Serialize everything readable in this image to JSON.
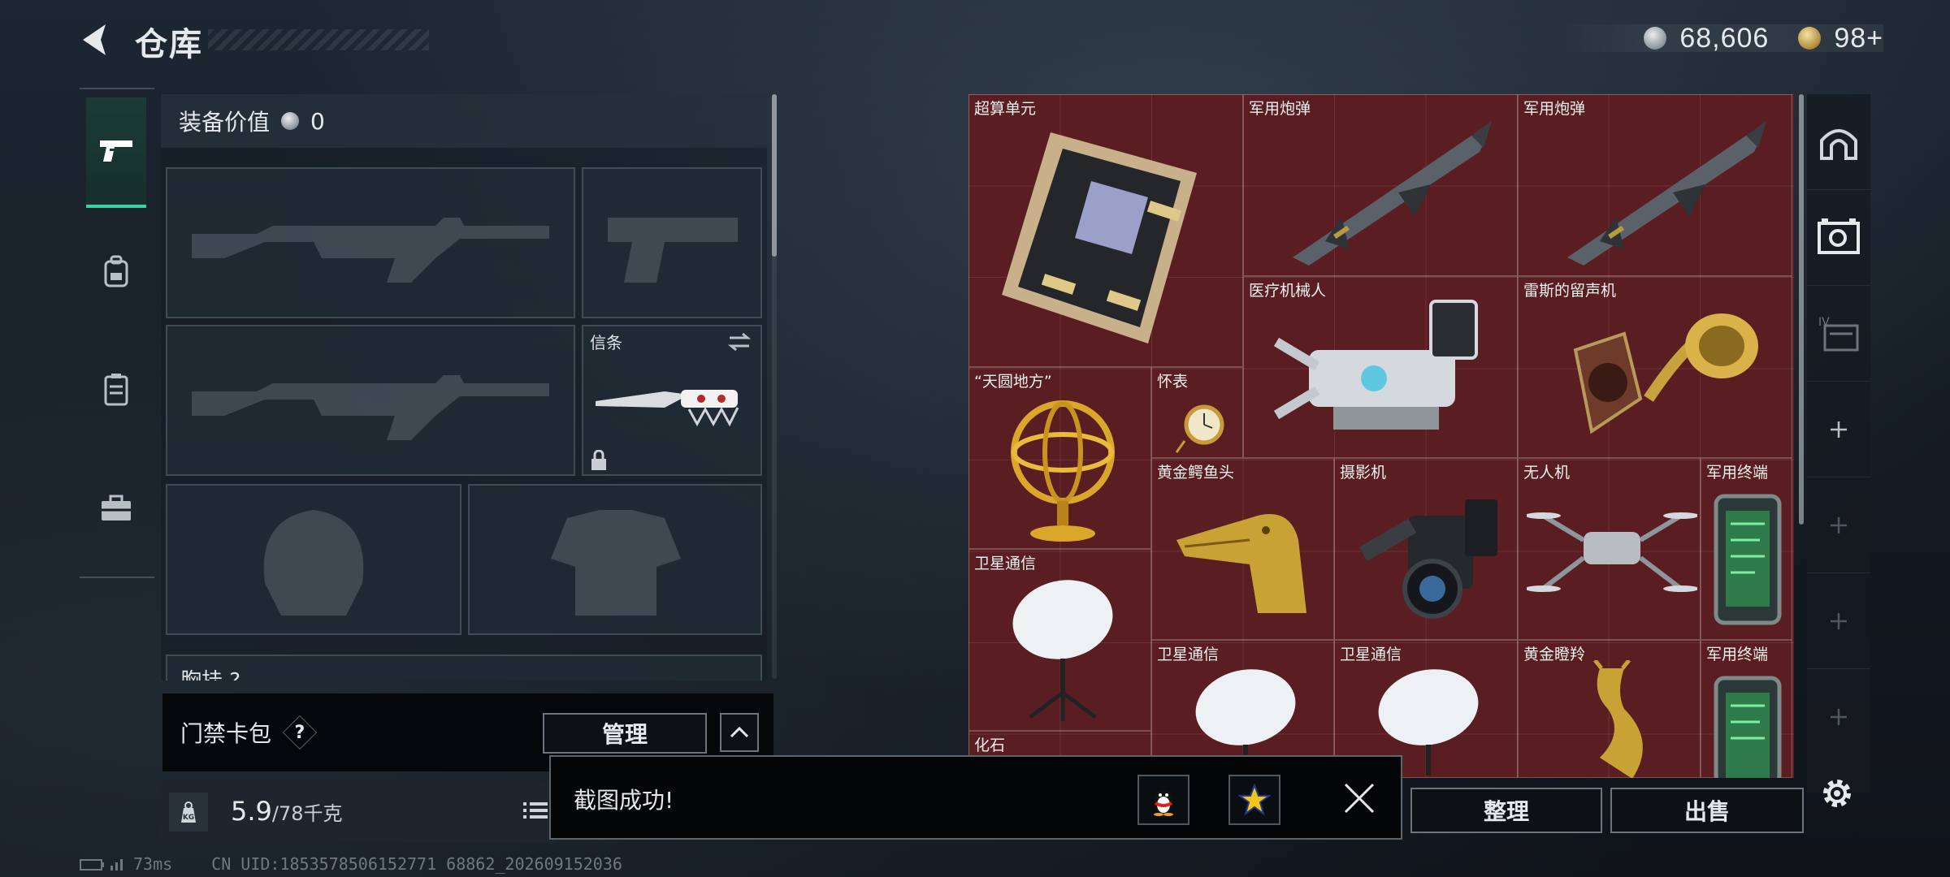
{
  "header": {
    "title": "仓库",
    "silver_amount": "68,606",
    "gold_amount": "98+"
  },
  "nav": {
    "items": [
      {
        "name": "weapons",
        "icon": "pistol-icon",
        "active": true
      },
      {
        "name": "backpack",
        "icon": "backpack-icon",
        "active": false
      },
      {
        "name": "vest",
        "icon": "vest-icon",
        "active": false
      },
      {
        "name": "case",
        "icon": "briefcase-icon",
        "active": false
      }
    ]
  },
  "equipment": {
    "value_label": "装备价值",
    "value": "0",
    "knife_label": "信条",
    "chest_label": "胸挂 ?"
  },
  "keycard": {
    "label": "门禁卡包",
    "help": "?",
    "manage": "管理"
  },
  "weight": {
    "current": "5.9",
    "max": "/78千克"
  },
  "stash": {
    "items": [
      {
        "name": "超算单元",
        "icon": "circuit-board-icon"
      },
      {
        "name": "军用炮弹",
        "icon": "missile-icon"
      },
      {
        "name": "军用炮弹",
        "icon": "missile-icon"
      },
      {
        "name": "医疗机械人",
        "icon": "medical-robot-icon"
      },
      {
        "name": "雷斯的留声机",
        "icon": "gramophone-icon"
      },
      {
        "name": "“天圆地方”",
        "icon": "armillary-sphere-icon"
      },
      {
        "name": "怀表",
        "icon": "pocket-watch-icon"
      },
      {
        "name": "黄金鳄鱼头",
        "icon": "golden-crocodile-icon"
      },
      {
        "name": "摄影机",
        "icon": "camera-icon"
      },
      {
        "name": "无人机",
        "icon": "drone-icon"
      },
      {
        "name": "军用终端",
        "icon": "terminal-icon"
      },
      {
        "name": "卫星通信",
        "icon": "satellite-dish-icon"
      },
      {
        "name": "卫星通信",
        "icon": "satellite-dish-icon"
      },
      {
        "name": "卫星通信",
        "icon": "satellite-dish-icon"
      },
      {
        "name": "黄金瞪羚",
        "icon": "golden-gazelle-icon"
      },
      {
        "name": "军用终端",
        "icon": "terminal-icon"
      },
      {
        "name": "化石",
        "icon": "fossil-icon"
      }
    ]
  },
  "actions": {
    "sort": "整理",
    "sell": "出售"
  },
  "toast": {
    "message": "截图成功!"
  },
  "status": {
    "ping": "73ms",
    "uid": "CN UID:1853578506152771 68862_202609152036"
  },
  "colors": {
    "accent": "#35d4a3",
    "stash_bg": "#5a1e22"
  }
}
